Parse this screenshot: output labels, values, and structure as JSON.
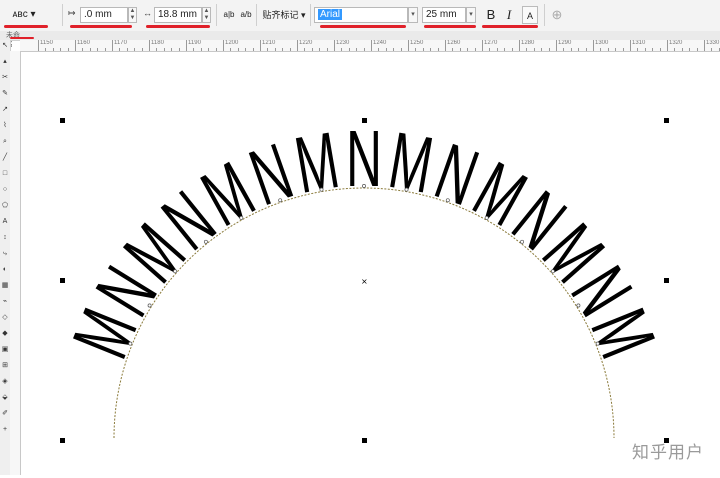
{
  "toolbar": {
    "arc_preset": "ᴀʙᴄ",
    "dist_label": "↦",
    "dist_value": ".0 mm",
    "offset_label": "↔",
    "offset_value": "18.8 mm",
    "mirror_h": "a|b",
    "mirror_v": "a/b",
    "snap_label": "贴齐标记",
    "font_name": "Arial",
    "font_size": "25 mm",
    "bold": "B",
    "italic": "I",
    "char_fmt": "A",
    "add": "⊕"
  },
  "tab": {
    "label": "未命名"
  },
  "ruler": {
    "ticks": [
      "1150",
      "1160",
      "1170",
      "1180",
      "1190",
      "1200",
      "1210",
      "1220",
      "1230",
      "1240",
      "1250",
      "1260",
      "1270",
      "1280",
      "1290",
      "1300",
      "1310",
      "1320",
      "1330"
    ]
  },
  "arc_text": [
    "M",
    "N",
    "M",
    "N",
    "M",
    "N",
    "M",
    "N",
    "M",
    "N",
    "M",
    "N",
    "M",
    "N",
    "M"
  ],
  "watermark": "知乎用户",
  "colors": {
    "accent": "#e0212a",
    "selection": "#3399ff"
  }
}
